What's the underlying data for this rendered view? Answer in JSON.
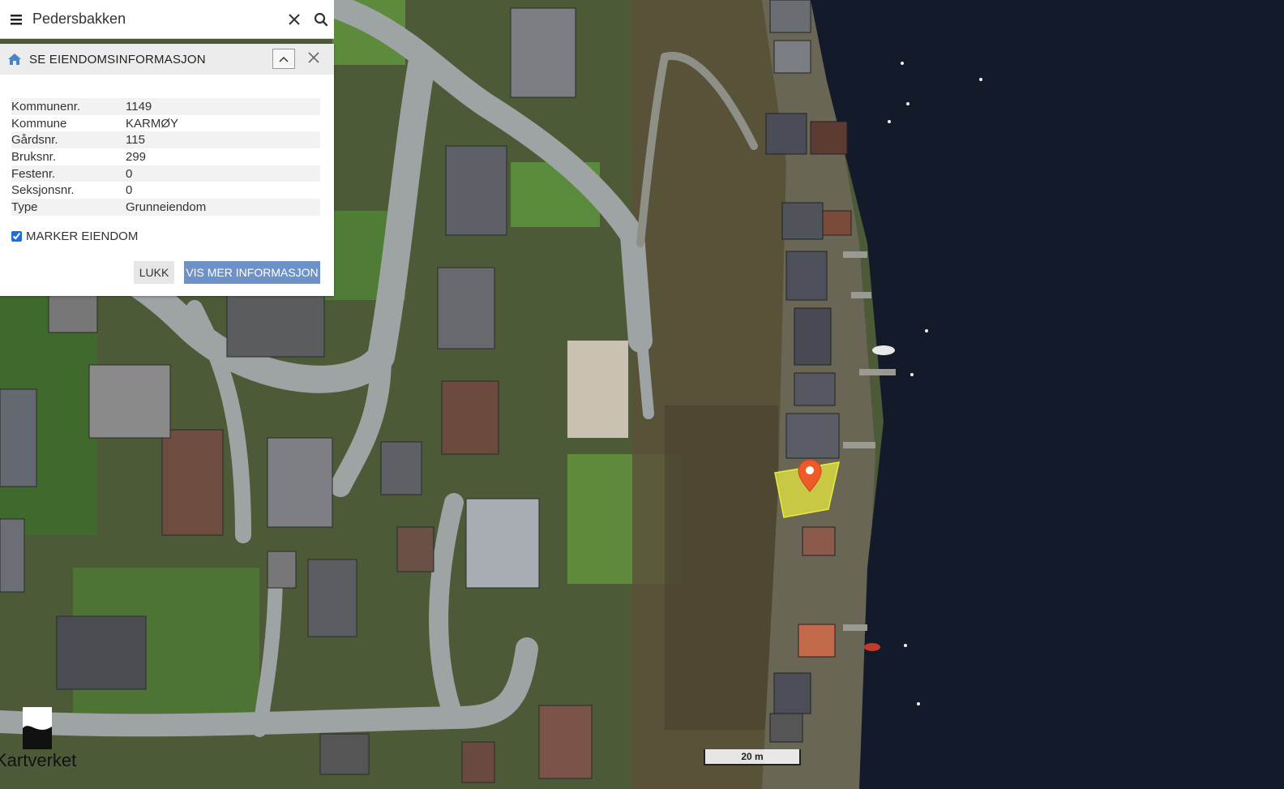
{
  "search": {
    "value": "Pedersbakken",
    "placeholder": ""
  },
  "panel": {
    "title": "SE EIENDOMSINFORMASJON",
    "rows": [
      {
        "key": "Kommunenr.",
        "value": "1149"
      },
      {
        "key": "Kommune",
        "value": "KARMØY"
      },
      {
        "key": "Gårdsnr.",
        "value": "115"
      },
      {
        "key": "Bruksnr.",
        "value": "299"
      },
      {
        "key": "Festenr.",
        "value": "0"
      },
      {
        "key": "Seksjonsnr.",
        "value": "0"
      },
      {
        "key": "Type",
        "value": "Grunneiendom"
      }
    ],
    "mark_label": "MARKER EIENDOM",
    "mark_checked": true,
    "close_button": "LUKK",
    "more_button": "VIS MER INFORMASJON"
  },
  "logo": {
    "text": "Kartverket"
  },
  "scale": {
    "label": "20 m"
  },
  "colors": {
    "accent": "#6d92c7",
    "marker": "#f05a28",
    "highlight": "#e8ea40",
    "water": "#131a2a"
  },
  "icons": {
    "menu": "menu-icon",
    "clear": "close-icon",
    "search": "search-icon",
    "home": "home-icon",
    "collapse": "chevron-up-icon",
    "panel_close": "close-icon",
    "marker": "location-pin-icon"
  }
}
